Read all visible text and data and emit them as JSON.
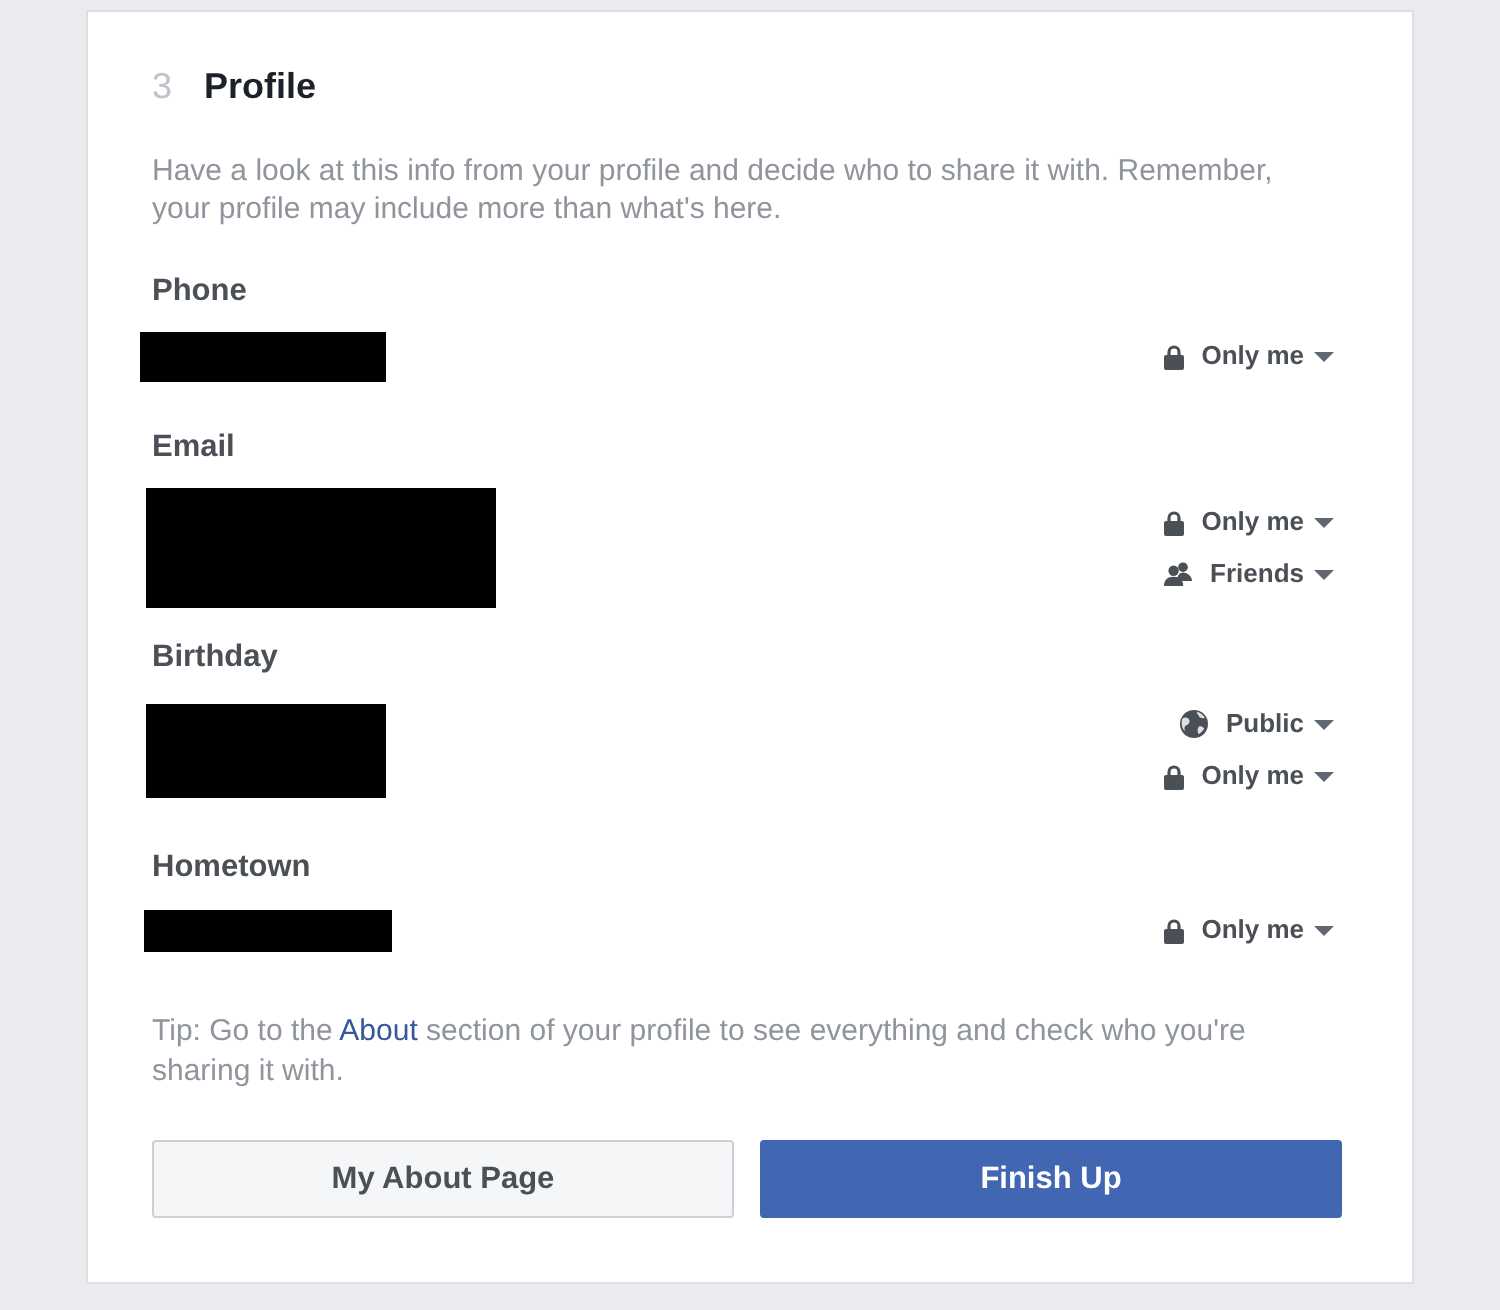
{
  "card": {
    "step": "3",
    "title": "Profile",
    "description": "Have a look at this info from your profile and decide who to share it with. Remember, your profile may include more than what's here."
  },
  "fields": [
    {
      "label": "Phone",
      "redacted": true,
      "audiences": [
        {
          "kind": "lock",
          "label": "Only me"
        }
      ]
    },
    {
      "label": "Email",
      "redacted": true,
      "audiences": [
        {
          "kind": "lock",
          "label": "Only me"
        },
        {
          "kind": "friends",
          "label": "Friends"
        }
      ]
    },
    {
      "label": "Birthday",
      "redacted": true,
      "audiences": [
        {
          "kind": "globe",
          "label": "Public"
        },
        {
          "kind": "lock",
          "label": "Only me"
        }
      ]
    },
    {
      "label": "Hometown",
      "redacted": true,
      "audiences": [
        {
          "kind": "lock",
          "label": "Only me"
        }
      ]
    }
  ],
  "tip": {
    "before": "Tip: Go to the ",
    "link": "About",
    "after": " section of your profile to see everything and check who you're sharing it with."
  },
  "buttons": [
    {
      "kind": "secondary",
      "label": "My About Page"
    },
    {
      "kind": "primary",
      "label": "Finish Up"
    }
  ]
}
